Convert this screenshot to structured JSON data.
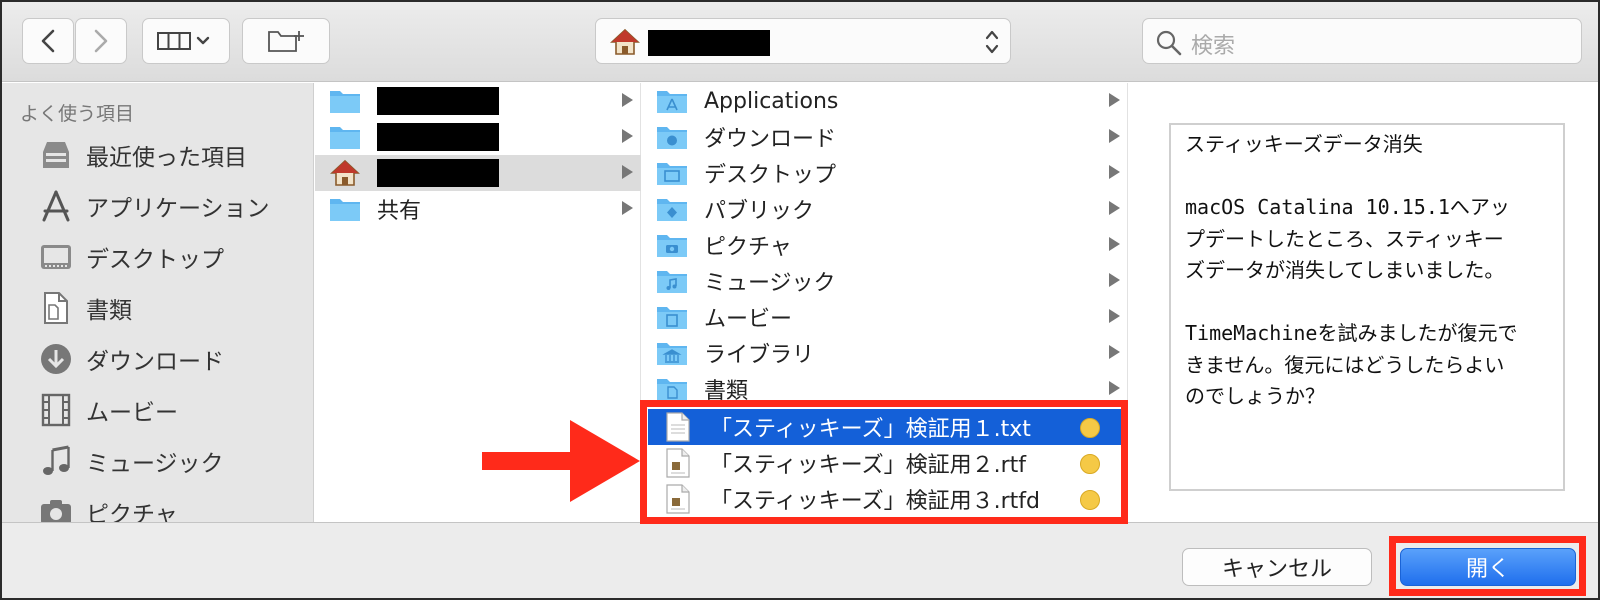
{
  "toolbar": {
    "back_icon": "chevron-left-icon",
    "forward_icon": "chevron-right-icon",
    "view_icon": "column-view-icon",
    "new_folder_icon": "new-folder-icon",
    "search_placeholder": "検索"
  },
  "sidebar": {
    "heading": "よく使う項目",
    "items": [
      {
        "label": "最近使った項目",
        "icon": "recents-icon"
      },
      {
        "label": "アプリケーション",
        "icon": "applications-icon"
      },
      {
        "label": "デスクトップ",
        "icon": "desktop-icon"
      },
      {
        "label": "書類",
        "icon": "documents-icon"
      },
      {
        "label": "ダウンロード",
        "icon": "downloads-icon"
      },
      {
        "label": "ムービー",
        "icon": "movies-icon"
      },
      {
        "label": "ミュージック",
        "icon": "music-icon"
      },
      {
        "label": "ピクチャ",
        "icon": "pictures-icon"
      }
    ]
  },
  "column1": {
    "shared_label": "共有"
  },
  "column2": {
    "folders": [
      {
        "label": "Applications",
        "icon": "applications-folder-icon"
      },
      {
        "label": "ダウンロード",
        "icon": "downloads-folder-icon"
      },
      {
        "label": "デスクトップ",
        "icon": "desktop-folder-icon"
      },
      {
        "label": "パブリック",
        "icon": "public-folder-icon"
      },
      {
        "label": "ピクチャ",
        "icon": "pictures-folder-icon"
      },
      {
        "label": "ミュージック",
        "icon": "music-folder-icon"
      },
      {
        "label": "ムービー",
        "icon": "movies-folder-icon"
      },
      {
        "label": "ライブラリ",
        "icon": "library-folder-icon"
      },
      {
        "label": "書類",
        "icon": "documents-folder-icon"
      }
    ],
    "files": [
      {
        "label": "「スティッキーズ」検証用１.txt",
        "selected": true,
        "tag_color": "#f5c946"
      },
      {
        "label": "「スティッキーズ」検証用２.rtf",
        "selected": false,
        "tag_color": "#f5c946"
      },
      {
        "label": "「スティッキーズ」検証用３.rtfd",
        "selected": false,
        "tag_color": "#f5c946"
      }
    ]
  },
  "preview": {
    "lines": [
      "スティッキーズデータ消失",
      "",
      "macOS Catalina 10.15.1へアッ",
      "プデートしたところ、スティッキー",
      "ズデータが消失してしまいました。",
      "",
      "TimeMachineを試みましたが復元で",
      "きません。復元にはどうしたらよい",
      "のでしょうか？"
    ]
  },
  "buttons": {
    "cancel": "キャンセル",
    "open": "開く"
  },
  "colors": {
    "selection": "#1460d8",
    "highlight_annotation": "#ff2a1a",
    "tag_yellow": "#f5c946",
    "folder_blue": "#6cc0f5"
  }
}
